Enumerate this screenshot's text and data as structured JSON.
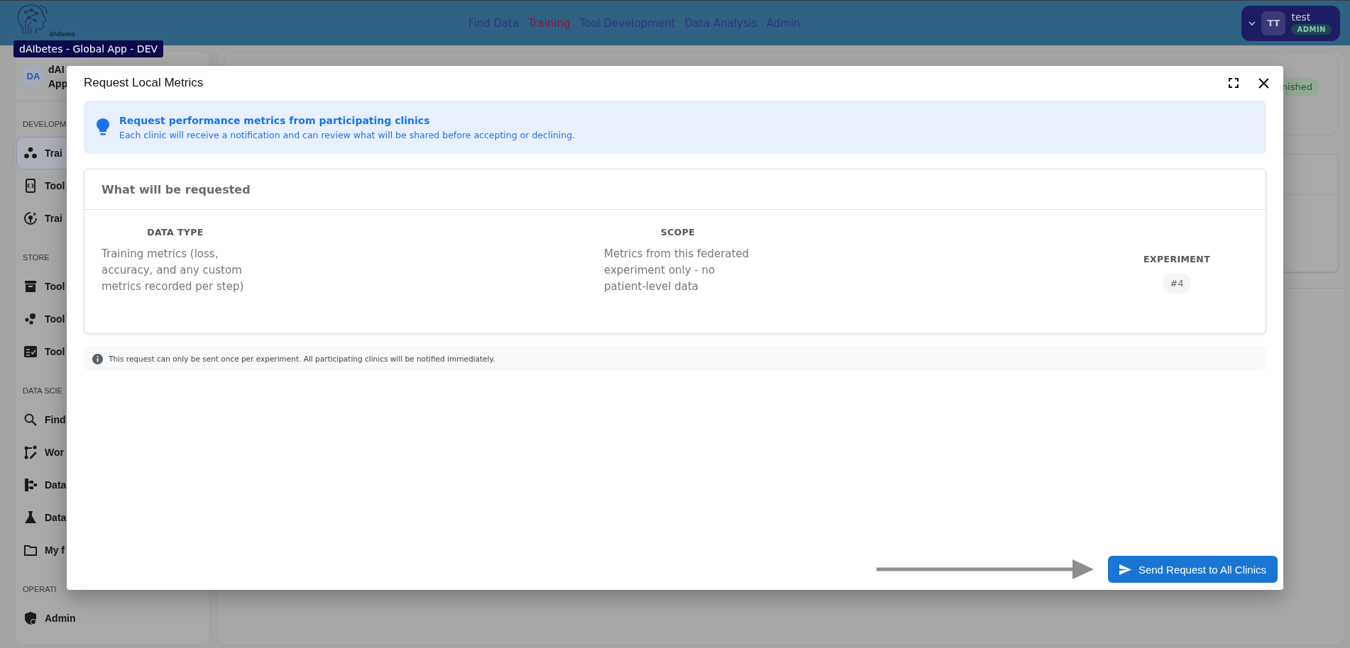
{
  "header": {
    "brand": "dAIbetes",
    "tooltip": "dAIbetes - Global App - DEV",
    "nav": [
      {
        "label": "Find Data",
        "selected": false
      },
      {
        "label": "Training",
        "selected": true
      },
      {
        "label": "Tool Development",
        "selected": false
      },
      {
        "label": "Data Analysis",
        "selected": false
      },
      {
        "label": "Admin",
        "selected": false
      }
    ],
    "account": {
      "initials": "TT",
      "name": "test",
      "role": "ADMIN"
    }
  },
  "sidebar": {
    "avatar": "DA",
    "title": [
      "dAI",
      "App"
    ],
    "sections": [
      {
        "label": "DEVELOPM",
        "items": [
          {
            "label": "Trai",
            "selected": true
          },
          {
            "label": "Tool",
            "selected": false
          },
          {
            "label": "Trai",
            "selected": false
          }
        ]
      },
      {
        "label": "STORE",
        "items": [
          {
            "label": "Tool",
            "selected": false
          },
          {
            "label": "Tool",
            "selected": false
          },
          {
            "label": "Tool",
            "selected": false
          }
        ]
      },
      {
        "label": "DATA SCIE",
        "items": [
          {
            "label": "Find",
            "selected": false
          },
          {
            "label": "Wor",
            "selected": false
          },
          {
            "label": "Data",
            "selected": false
          },
          {
            "label": "Data",
            "selected": false
          },
          {
            "label": "My f",
            "selected": false
          }
        ]
      },
      {
        "label": "OPERATI",
        "items": [
          {
            "label": "Admin",
            "selected": false
          }
        ]
      }
    ]
  },
  "main": {
    "status_badge": "nished"
  },
  "dialog": {
    "title": "Request Local Metrics",
    "alert": {
      "title": "Request performance metrics from participating clinics",
      "message": "Each clinic will receive a notification and can review what will be shared before accepting or declining."
    },
    "summary": {
      "heading": "What will be requested",
      "columns": [
        {
          "label": "DATA TYPE",
          "value": "Training metrics (loss, accuracy, and any custom metrics recorded per step)",
          "kind": "text"
        },
        {
          "label": "SCOPE",
          "value": "Metrics from this federated experiment only - no patient-level data",
          "kind": "text"
        },
        {
          "label": "EXPERIMENT",
          "value": "#4",
          "kind": "chip"
        }
      ]
    },
    "note": "This request can only be sent once per experiment. All participating clinics will be notified immediately.",
    "action": "Send Request to All Clinics"
  }
}
